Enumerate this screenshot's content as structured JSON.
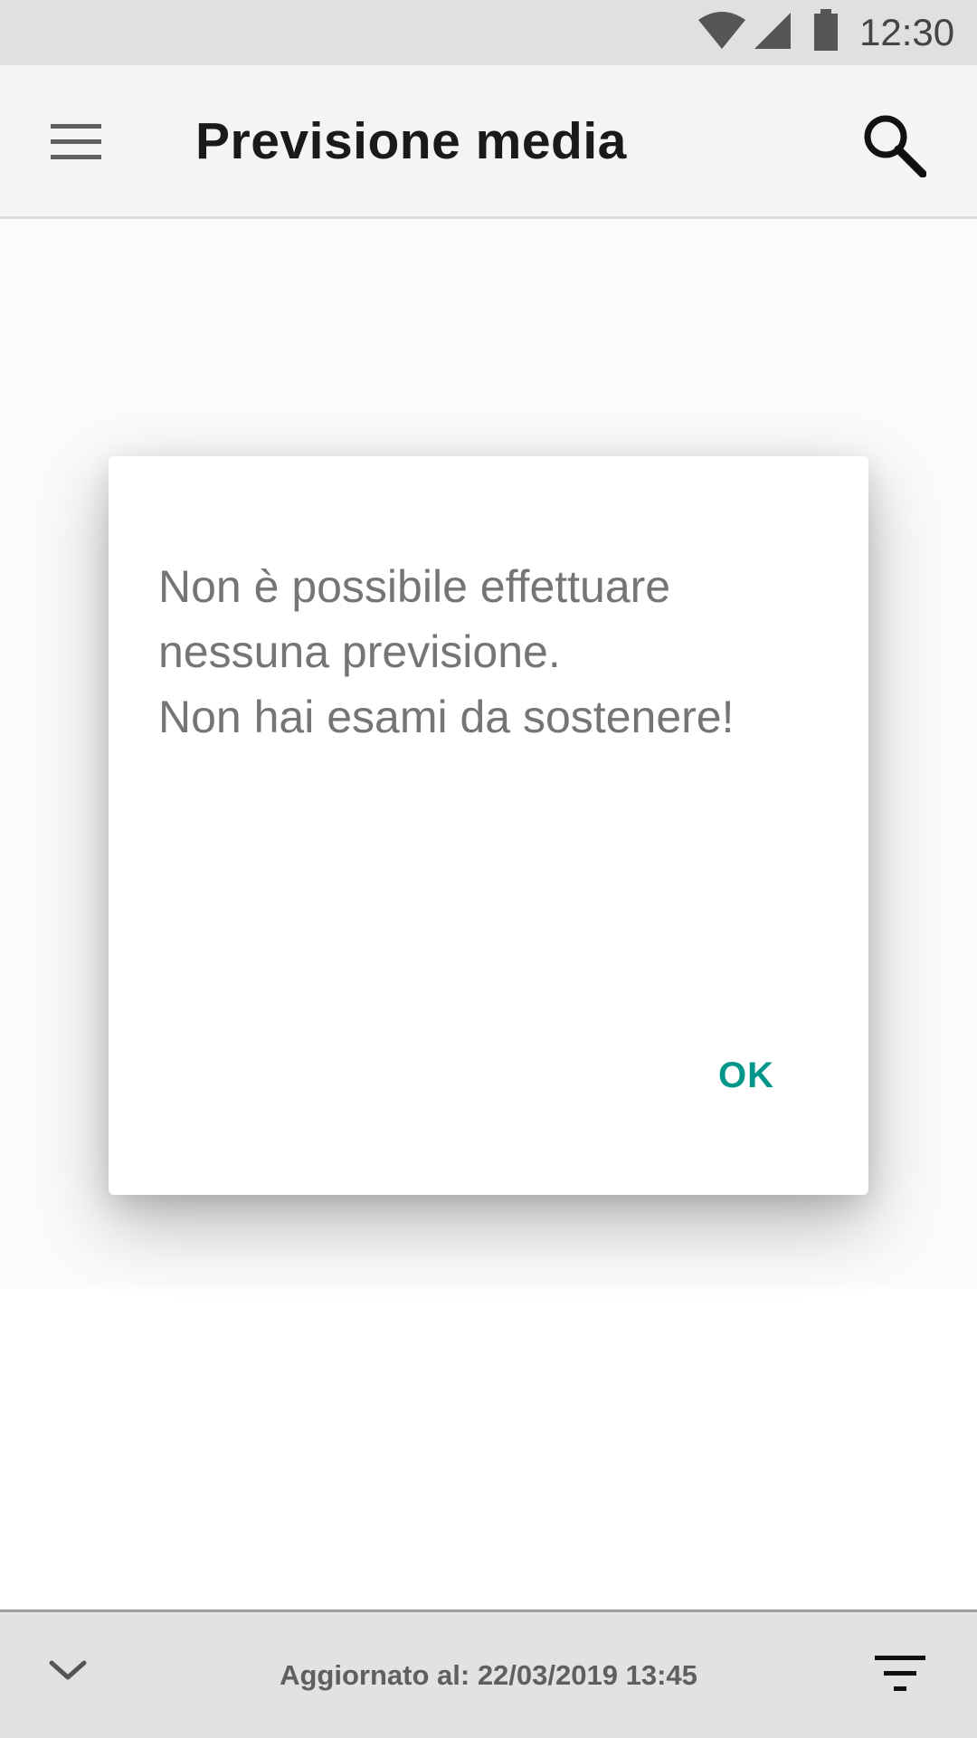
{
  "status_bar": {
    "time": "12:30",
    "icons": [
      "wifi-icon",
      "signal-icon",
      "battery-icon"
    ]
  },
  "app_bar": {
    "title": "Previsione media",
    "menu_icon": "hamburger-menu-icon",
    "search_icon": "search-icon"
  },
  "dialog": {
    "message_lines": [
      "Non è possibile effettuare",
      "nessuna previsione.",
      "Non hai esami da sostenere!"
    ],
    "ok_label": "OK",
    "accent_color": "#00968a"
  },
  "bottom_bar": {
    "updated_text": "Aggiornato al: 22/03/2019 13:45",
    "expand_icon": "chevron-down-icon",
    "filter_icon": "filter-icon"
  }
}
